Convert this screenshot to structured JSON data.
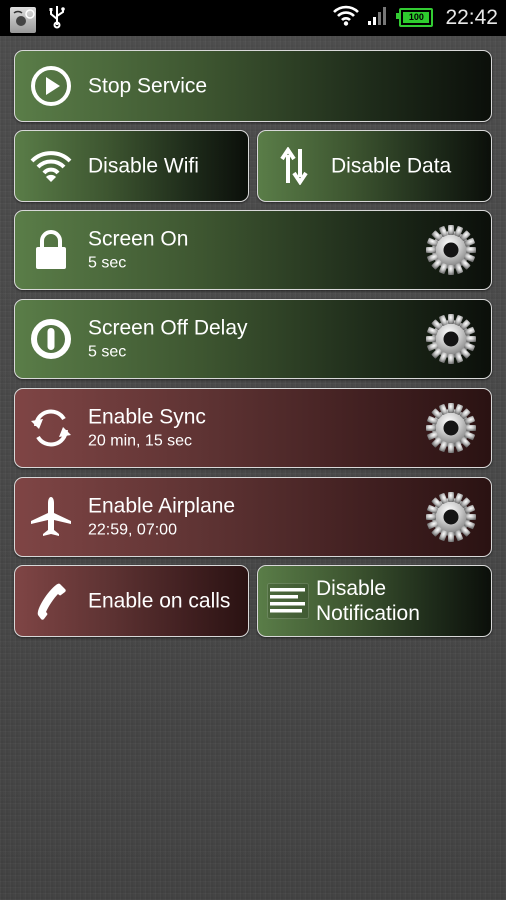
{
  "status_bar": {
    "time": "22:42",
    "battery_level": "100",
    "left_icons": [
      "app-notification-icon",
      "usb-icon"
    ],
    "right_icons": [
      "wifi-icon",
      "signal-icon",
      "battery-icon"
    ]
  },
  "colors": {
    "enabled_tile": "#5a7d48",
    "disabled_tile": "#7f4545",
    "border": "#d8d8d8"
  },
  "tiles": [
    {
      "label": "Stop Service",
      "icon": "play-icon",
      "color": "green"
    },
    {
      "label": "Disable Wifi",
      "icon": "wifi-icon",
      "color": "green"
    },
    {
      "label": "Disable Data",
      "icon": "data-arrows-icon",
      "color": "green"
    },
    {
      "label": "Screen On",
      "sub": "5 sec",
      "icon": "lock-icon",
      "color": "green",
      "settings": "gear-icon"
    },
    {
      "label": "Screen Off Delay",
      "sub": "5 sec",
      "icon": "power-icon",
      "color": "green",
      "settings": "gear-icon"
    },
    {
      "label": "Enable Sync",
      "sub": "20 min, 15 sec",
      "icon": "sync-icon",
      "color": "red",
      "settings": "gear-icon"
    },
    {
      "label": "Enable Airplane",
      "sub": "22:59, 07:00",
      "icon": "airplane-icon",
      "color": "red",
      "settings": "gear-icon"
    },
    {
      "label": "Enable  on calls",
      "icon": "phone-icon",
      "color": "red"
    },
    {
      "label": "Disable Notification",
      "label_line1": "Disable",
      "label_line2": "Notification",
      "icon": "notification-icon",
      "color": "green"
    }
  ]
}
